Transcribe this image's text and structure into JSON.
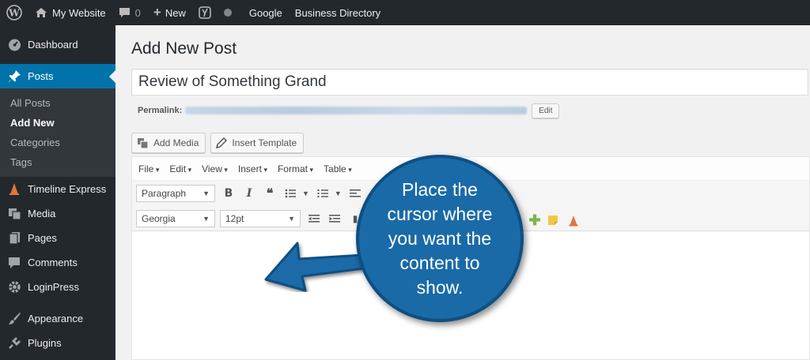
{
  "adminbar": {
    "site_name": "My Website",
    "comments_count": "0",
    "new_label": "New",
    "google_label": "Google",
    "directory_label": "Business Directory"
  },
  "sidebar": {
    "items": [
      {
        "label": "Dashboard",
        "icon": "dashboard-icon"
      },
      {
        "label": "Posts",
        "icon": "pin-icon"
      },
      {
        "label": "Timeline Express",
        "icon": "cone-icon"
      },
      {
        "label": "Media",
        "icon": "media-icon"
      },
      {
        "label": "Pages",
        "icon": "pages-icon"
      },
      {
        "label": "Comments",
        "icon": "comment-icon"
      },
      {
        "label": "LoginPress",
        "icon": "gear-icon"
      },
      {
        "label": "Appearance",
        "icon": "brush-icon"
      },
      {
        "label": "Plugins",
        "icon": "plug-icon"
      }
    ],
    "submenu": [
      "All Posts",
      "Add New",
      "Categories",
      "Tags"
    ]
  },
  "main": {
    "page_title": "Add New Post",
    "post_title_value": "Review of Something Grand",
    "permalink_label": "Permalink:",
    "edit_label": "Edit",
    "add_media_label": "Add Media",
    "insert_template_label": "Insert Template"
  },
  "editor": {
    "menu": [
      "File",
      "Edit",
      "View",
      "Insert",
      "Format",
      "Table"
    ],
    "format_select": "Paragraph",
    "font_select": "Georgia",
    "size_select": "12pt"
  },
  "callout": {
    "text": "Place the cursor where you want the content to show."
  },
  "colors": {
    "admin_bg": "#23282d",
    "accent": "#0073aa",
    "callout_bg": "#1a6aa8"
  }
}
